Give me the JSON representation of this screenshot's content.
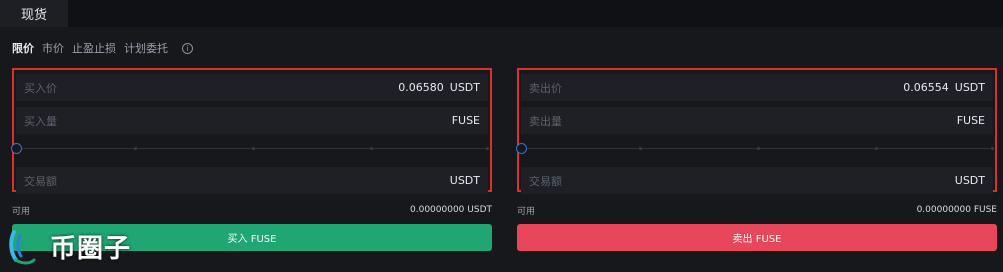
{
  "tabs": {
    "spot_label": "现货"
  },
  "order_types": {
    "limit": "限价",
    "market": "市价",
    "stop_limit": "止盈止损",
    "plan": "计划委托",
    "info_icon": "info-icon"
  },
  "buy_panel": {
    "price_label": "买入价",
    "price_value": "0.06580",
    "price_unit": "USDT",
    "amount_label": "买入量",
    "amount_unit": "FUSE",
    "total_label": "交易额",
    "total_unit": "USDT",
    "slider_percent": 0,
    "available_label": "可用",
    "available_value": "0.00000000 USDT",
    "button_label": "买入 FUSE"
  },
  "sell_panel": {
    "price_label": "卖出价",
    "price_value": "0.06554",
    "price_unit": "USDT",
    "amount_label": "卖出量",
    "amount_unit": "FUSE",
    "total_label": "交易额",
    "total_unit": "USDT",
    "slider_percent": 0,
    "available_label": "可用",
    "available_value": "0.00000000 FUSE",
    "button_label": "卖出 FUSE"
  },
  "watermark": {
    "text": "币圈子"
  },
  "colors": {
    "buy": "#1fa672",
    "sell": "#e8475b",
    "highlight_border": "#d8322b",
    "slider_knob": "#3b6fd3"
  }
}
